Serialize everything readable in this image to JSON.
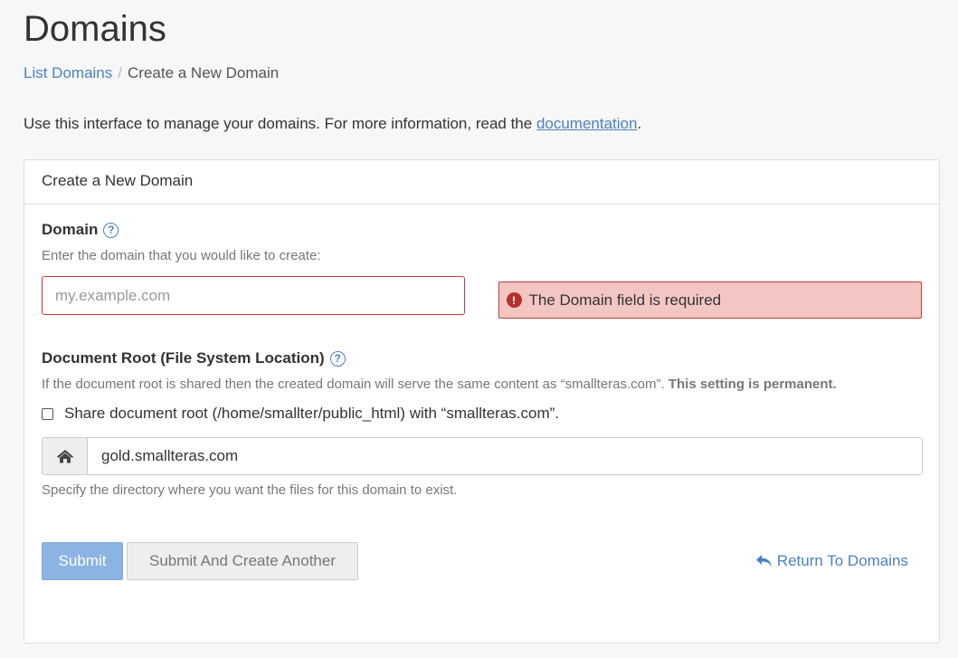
{
  "page": {
    "title": "Domains",
    "intro_text": "Use this interface to manage your domains. For more information, read the ",
    "intro_link": "documentation",
    "intro_end": "."
  },
  "breadcrumb": {
    "items": [
      {
        "label": "List Domains"
      },
      {
        "label": "Create a New Domain"
      }
    ],
    "separator": "/"
  },
  "panel": {
    "heading": "Create a New Domain"
  },
  "domain_field": {
    "label": "Domain",
    "hint": "Enter the domain that you would like to create:",
    "placeholder": "my.example.com",
    "value": "",
    "error": "The Domain field is required"
  },
  "docroot_field": {
    "label": "Document Root (File System Location)",
    "hint_text": "If the document root is shared then the created domain will serve the same content as “smallteras.com”. ",
    "hint_bold": "This setting is permanent.",
    "share_label": "Share document root (/home/smallter/public_html) with “smallteras.com”.",
    "share_checked": false,
    "value": "gold.smallteras.com",
    "help": "Specify the directory where you want the files for this domain to exist."
  },
  "actions": {
    "submit_label": "Submit",
    "submit_another_label": "Submit And Create Another",
    "return_label": "Return To Domains"
  },
  "icons": {
    "help": "question-circle-icon",
    "error": "exclamation-circle-icon",
    "home": "home-icon",
    "return": "reply-arrow-icon"
  },
  "colors": {
    "link": "#4a80c4",
    "error_border": "#c33a3a",
    "error_bg": "#f4c6c3",
    "primary_button": "#8bb4e2"
  }
}
